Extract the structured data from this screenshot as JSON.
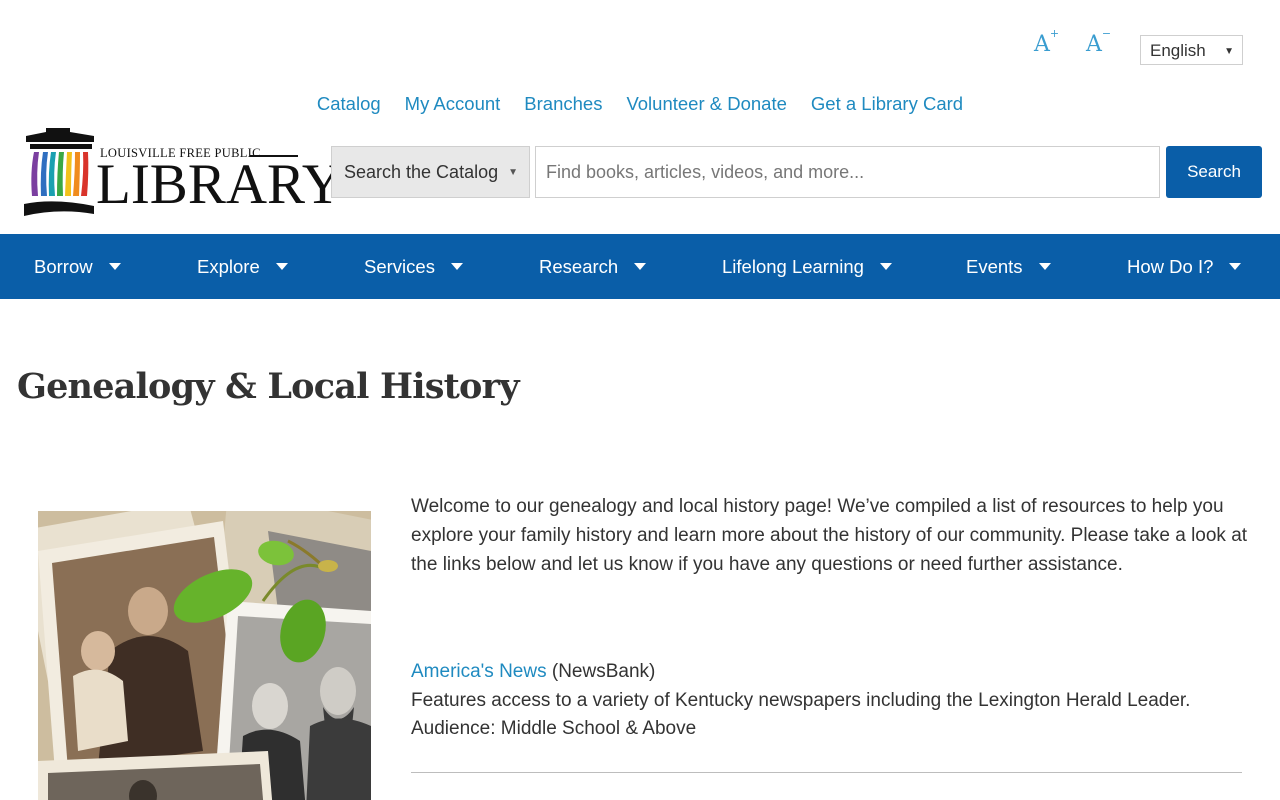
{
  "utility": {
    "font_increase_label": "A",
    "font_increase_sup": "+",
    "font_decrease_label": "A",
    "font_decrease_sup": "−",
    "language": "English"
  },
  "top_links": [
    "Catalog",
    "My Account",
    "Branches",
    "Volunteer & Donate",
    "Get a Library Card"
  ],
  "logo": {
    "small_text": "LOUISVILLE FREE PUBLIC",
    "big_text": "LIBRARY"
  },
  "search": {
    "scope": "Search the Catalog",
    "placeholder": "Find books, articles, videos, and more...",
    "button_label": "Search"
  },
  "main_nav": [
    "Borrow",
    "Explore",
    "Services",
    "Research",
    "Lifelong Learning",
    "Events",
    "How Do I?"
  ],
  "page": {
    "title": "Genealogy & Local History",
    "intro": "Welcome to our genealogy and local history page! We’ve compiled a list of resources to help you explore your family history and learn more about the history of our community. Please take a look at the links below and let us know if you have any questions or need further assistance."
  },
  "resources": [
    {
      "link": "America's News",
      "provider": " (NewsBank)",
      "description": "Features access to a variety of Kentucky newspapers including the Lexington Herald Leader.",
      "audience": "Audience: Middle School & Above"
    }
  ],
  "colors": {
    "brand_blue": "#0a5ea8",
    "link_blue": "#1f8ac0",
    "logo_stripes": [
      "#7b3fa0",
      "#2f6fc0",
      "#1aa0b0",
      "#3aa845",
      "#f2c21b",
      "#f08c1e",
      "#d9342b"
    ]
  }
}
